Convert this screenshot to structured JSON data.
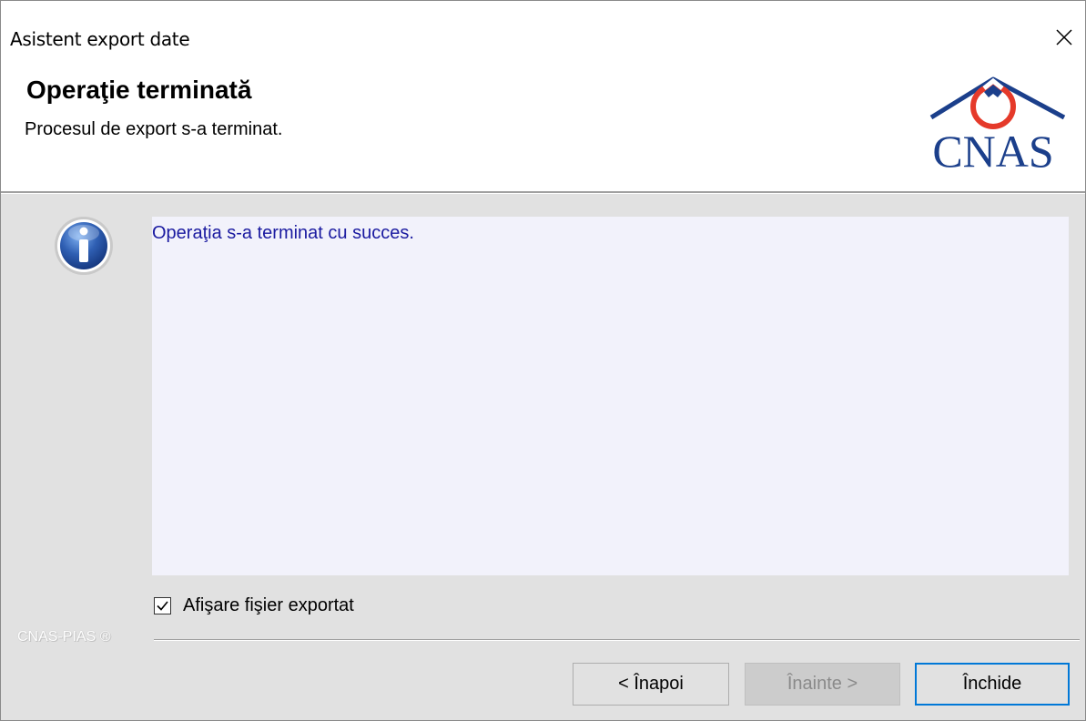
{
  "window": {
    "title": "Asistent export date",
    "close_label": "×"
  },
  "header": {
    "title": "Operaţie terminată",
    "subtitle": "Procesul de export s-a terminat.",
    "logo_text": "CNAS"
  },
  "message": {
    "text": "Operaţia s-a terminat cu succes."
  },
  "options": {
    "show_exported_file": {
      "label": "Afişare fişier exportat",
      "checked": true
    }
  },
  "brand": {
    "text": "CNAS-PIAS ®"
  },
  "buttons": {
    "back": "< Înapoi",
    "next": "Înainte >",
    "close": "Închide"
  },
  "colors": {
    "message_text": "#1a1aa0",
    "logo_blue": "#1b3f8b",
    "logo_red": "#e53a2a",
    "info_icon_blue": "#2f5fb3",
    "default_button_border": "#0078d7"
  },
  "icons": {
    "info": "info-icon",
    "close": "close-icon",
    "checkmark": "checkmark-icon"
  }
}
